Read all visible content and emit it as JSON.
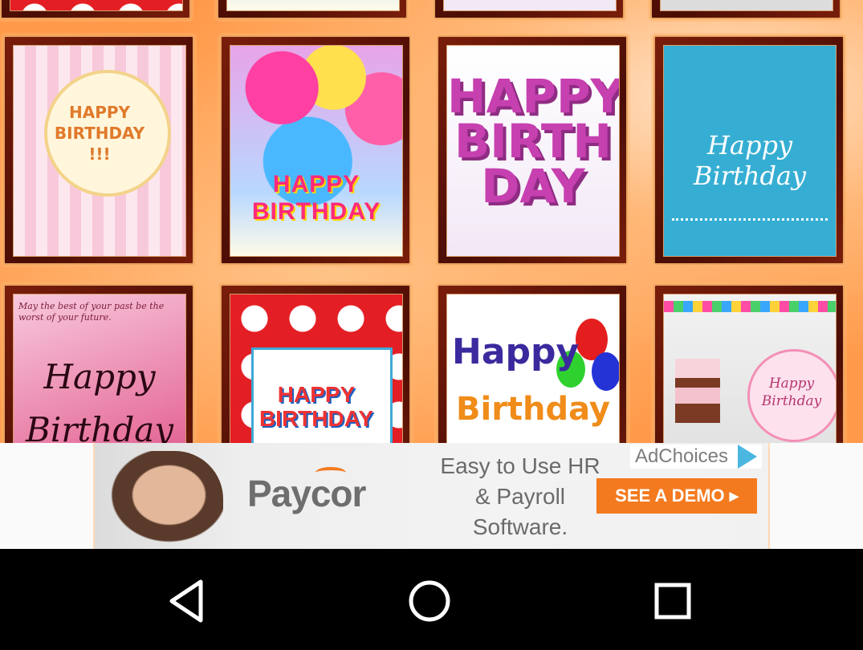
{
  "cards": [
    {
      "id": "card-1",
      "lines": [
        "HAPPY",
        "BIRTHDAY",
        "!!!"
      ]
    },
    {
      "id": "card-2",
      "lines": [
        "HAPPY BIRTHDAY"
      ]
    },
    {
      "id": "card-3",
      "lines": [
        "HAPPY",
        "BIRTH",
        "DAY"
      ]
    },
    {
      "id": "card-4",
      "lines": [
        "Happy Birthday"
      ]
    },
    {
      "id": "card-5",
      "small": "May the best of your past be the worst of your future.",
      "lines": [
        "Happy",
        "Birthday"
      ]
    },
    {
      "id": "card-6",
      "lines": [
        "HAPPY",
        "BIRTHDAY"
      ]
    },
    {
      "id": "card-7",
      "lines": [
        "Happy",
        "Birthday"
      ]
    },
    {
      "id": "card-8",
      "lines": [
        "Happy",
        "Birthday"
      ]
    }
  ],
  "ad": {
    "brand": "Paycor",
    "tagline": "Easy to Use HR & Payroll Software.",
    "adchoices": "AdChoices",
    "cta": "SEE A DEMO ▸"
  },
  "nav": {
    "back": "back-icon",
    "home": "home-icon",
    "recents": "recents-icon"
  },
  "colors": {
    "frame": "#5a1206",
    "accent": "#f47a1f",
    "navbar": "#000000"
  }
}
